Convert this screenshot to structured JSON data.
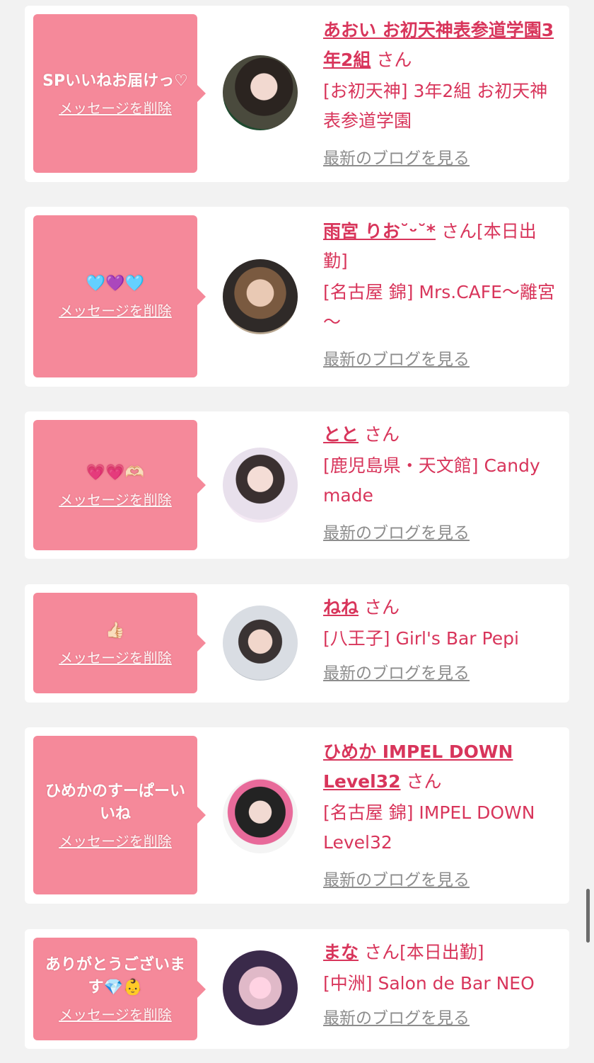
{
  "items": [
    {
      "message": "SPいいねお届けっ♡",
      "delete_label": "メッセージを削除",
      "name": "あおい お初天神表参道学園3年2組",
      "honorific": "さん",
      "shop": "[お初天神] 3年2組 お初天神表参道学園",
      "blog_label": "最新のブログを見る"
    },
    {
      "message": "🩵💜🩵",
      "delete_label": "メッセージを削除",
      "name": "雨宮 りお˘ᵕ˘*",
      "honorific": "さん[本日出勤]",
      "shop": "[名古屋 錦] Mrs.CAFE～離宮～",
      "blog_label": "最新のブログを見る"
    },
    {
      "message": "💗💗🫶🏻",
      "delete_label": "メッセージを削除",
      "name": "とと",
      "honorific": "さん",
      "shop": "[鹿児島県・天文館] Candy made",
      "blog_label": "最新のブログを見る"
    },
    {
      "message": "👍🏻",
      "delete_label": "メッセージを削除",
      "name": "ねね",
      "honorific": "さん",
      "shop": "[八王子] Girl's Bar Pepi",
      "blog_label": "最新のブログを見る"
    },
    {
      "message": "ひめかのすーぱーいいね",
      "delete_label": "メッセージを削除",
      "name": "ひめか IMPEL DOWN Level32",
      "honorific": "さん",
      "shop": "[名古屋 錦] IMPEL DOWN Level32",
      "blog_label": "最新のブログを見る"
    },
    {
      "message": "ありがとうございます💎👶",
      "delete_label": "メッセージを削除",
      "name": "まな",
      "honorific": "さん[本日出勤]",
      "shop": "[中洲] Salon de Bar NEO",
      "blog_label": "最新のブログを見る"
    }
  ],
  "colors": {
    "accent": "#d8355b",
    "bubble": "#f5899a",
    "background": "#f2f2f2",
    "link_gray": "#8d8d8d"
  }
}
